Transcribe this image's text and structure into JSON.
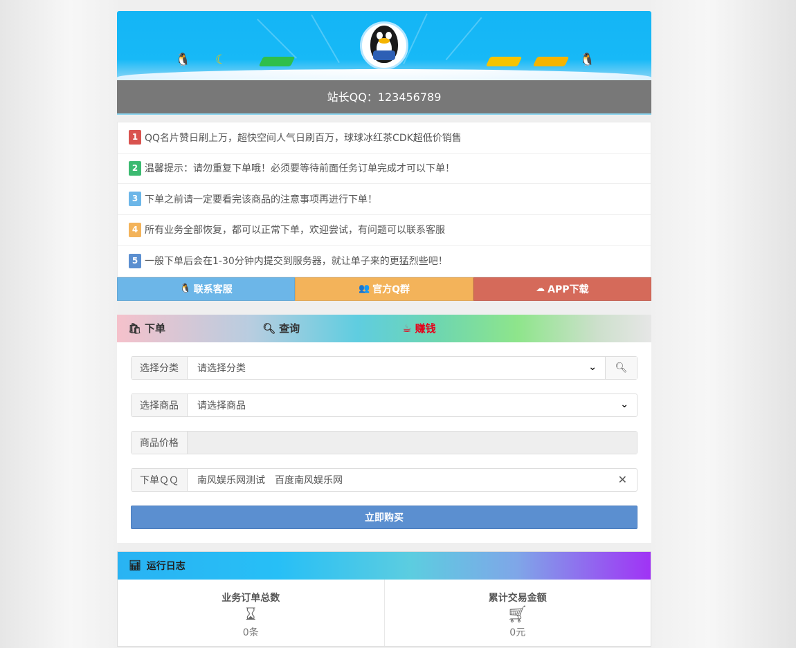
{
  "owner": {
    "text": "站长QQ：123456789"
  },
  "notices": [
    {
      "num": "1",
      "color": "#d9534f",
      "text": "QQ名片赞日刷上万，超快空间人气日刷百万，球球冰红茶CDK超低价销售"
    },
    {
      "num": "2",
      "color": "#3cba71",
      "text": "温馨提示：请勿重复下单哦！必须要等待前面任务订单完成才可以下单！"
    },
    {
      "num": "3",
      "color": "#6cb6e8",
      "text": "下单之前请一定要看完该商品的注意事项再进行下单！"
    },
    {
      "num": "4",
      "color": "#f3b35a",
      "text": "所有业务全部恢复，都可以正常下单，欢迎尝试，有问题可以联系客服"
    },
    {
      "num": "5",
      "color": "#5b8fd0",
      "text": "一般下单后会在1-30分钟内提交到服务器，就让单子来的更猛烈些吧！"
    }
  ],
  "actions": [
    {
      "icon": "qq-icon",
      "label": "联系客服",
      "color": "#6cb6e8"
    },
    {
      "icon": "users-icon",
      "label": "官方Q群",
      "color": "#f3b35a"
    },
    {
      "icon": "cloud-download-icon",
      "label": "APP下载",
      "color": "#d56a5a"
    }
  ],
  "tabs": [
    {
      "icon": "shopping-bag-icon",
      "label": "下单",
      "color": "#333333"
    },
    {
      "icon": "search-icon",
      "label": "查询",
      "color": "#333333"
    },
    {
      "icon": "coffee-icon",
      "label": "赚钱",
      "color": "#e6001a"
    }
  ],
  "form": {
    "category_label": "选择分类",
    "category_value": "请选择分类",
    "product_label": "选择商品",
    "product_value": "请选择商品",
    "price_label": "商品价格",
    "price_value": "",
    "qq_label": "下单ＱＱ",
    "qq_value": "南风娱乐网测试　百度南风娱乐网",
    "buy_label": "立即购买"
  },
  "log": {
    "title": "运行日志",
    "stats": [
      {
        "title": "业务订单总数",
        "icon": "hourglass-icon",
        "value": "0条"
      },
      {
        "title": "累计交易金额",
        "icon": "cart-icon",
        "value": "0元"
      }
    ]
  }
}
